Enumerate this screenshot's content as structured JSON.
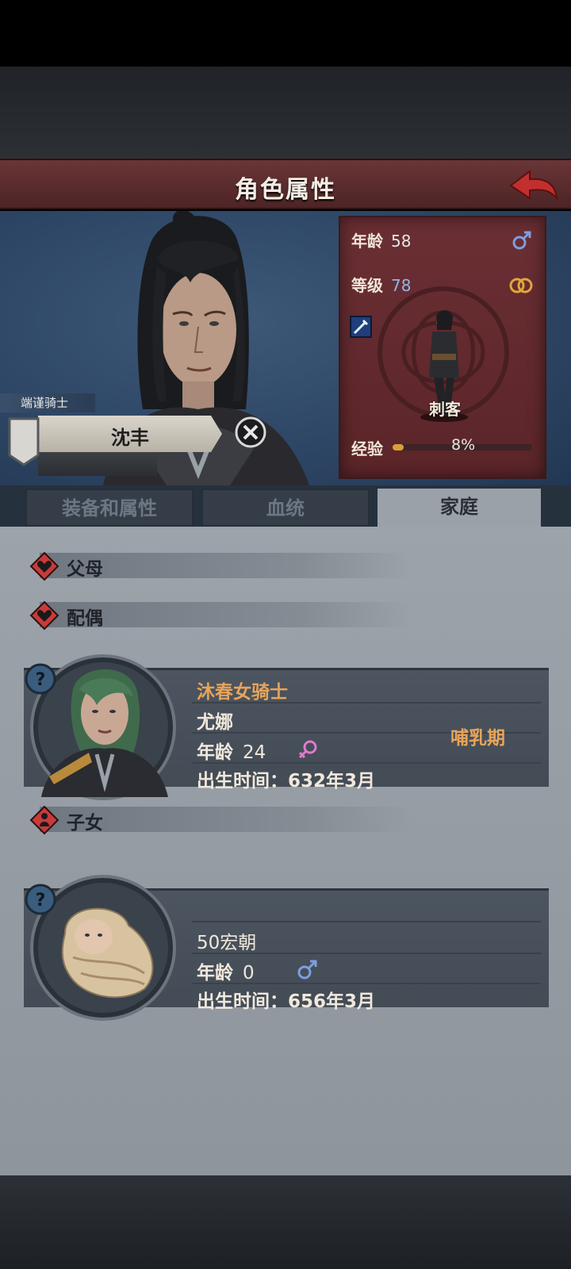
{
  "header": {
    "title": "角色属性"
  },
  "character": {
    "title": "端谨骑士",
    "name": "沈丰",
    "stats": {
      "age_label": "年龄",
      "age": "58",
      "level_label": "等级",
      "level": "78",
      "job": "刺客",
      "exp_label": "经验",
      "exp_pct": "8%",
      "exp_fraction": 0.08
    }
  },
  "tabs": [
    "装备和属性",
    "血统",
    "家庭"
  ],
  "active_tab": 2,
  "family": {
    "parents_label": "父母",
    "spouse_label": "配偶",
    "children_label": "子女",
    "spouse": {
      "title": "沐春女骑士",
      "name": "尤娜",
      "age_label": "年龄",
      "age": "24",
      "birth": "出生时间：632年3月",
      "status": "哺乳期"
    },
    "child": {
      "name": "50宏朝",
      "age_label": "年龄",
      "age": "0",
      "birth": "出生时间：656年3月"
    }
  },
  "colors": {
    "accent_red": "#c93a3a",
    "female": "#e07acb",
    "male": "#6f8ed8",
    "gold": "#e7a45a"
  }
}
